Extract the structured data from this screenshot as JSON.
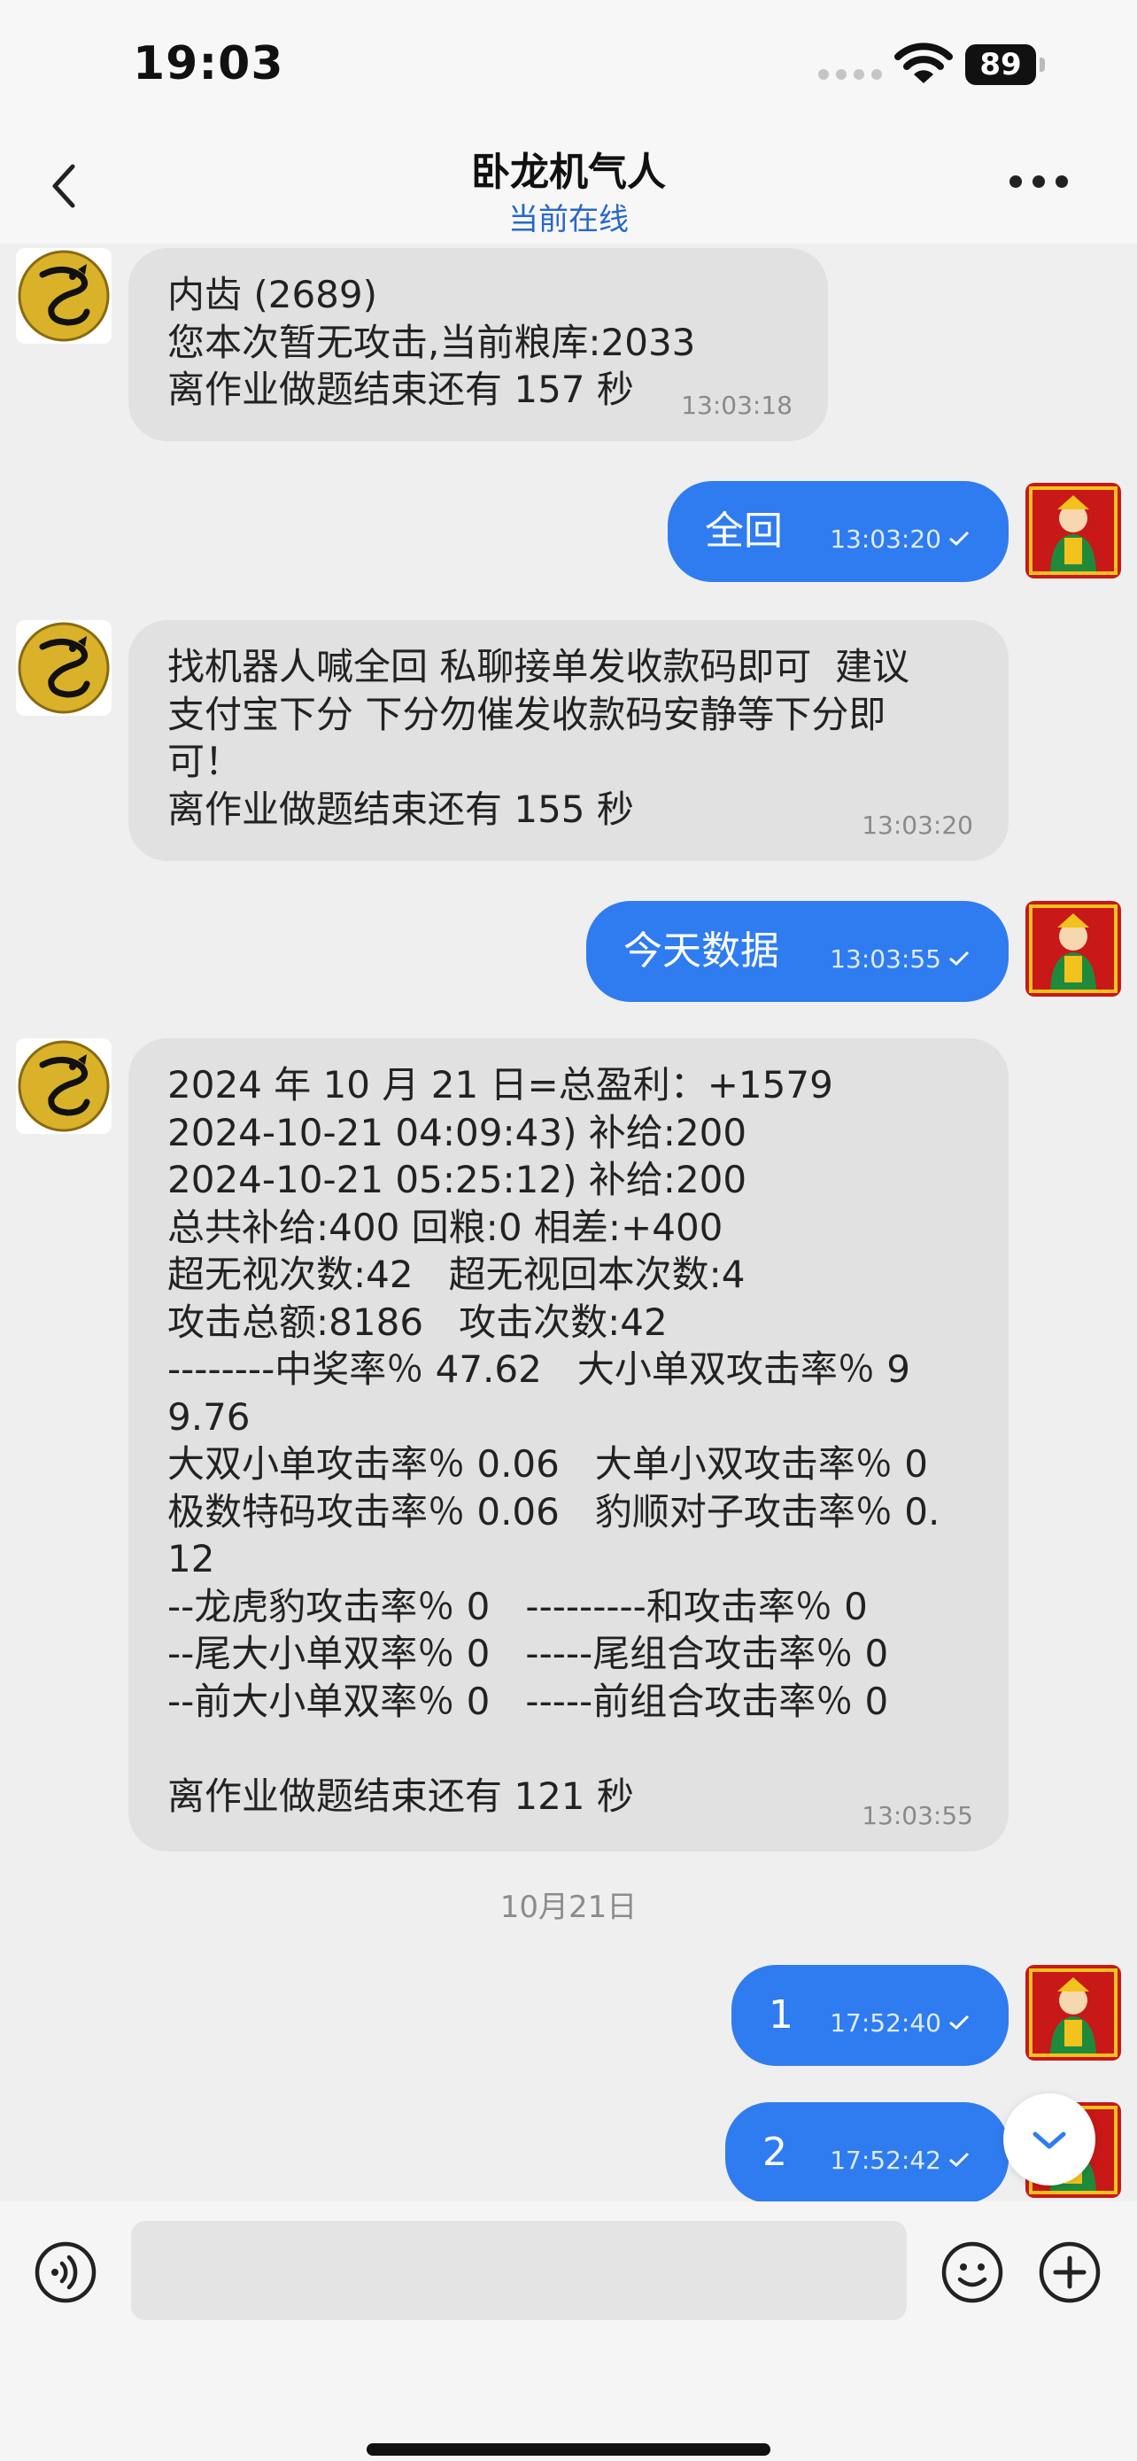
{
  "status_bar": {
    "time": "19:03",
    "battery": "89"
  },
  "header": {
    "title": "卧龙机气人",
    "subtitle": "当前在线"
  },
  "messages": [
    {
      "direction": "in",
      "lines": [
        "内齿 (2689)",
        "您本次暂无攻击,当前粮库:2033",
        "离作业做题结束还有 157 秒"
      ],
      "time": "13:03:18"
    },
    {
      "direction": "out",
      "text": "全回",
      "time": "13:03:20"
    },
    {
      "direction": "in",
      "lines": [
        "找机器人喊全回 私聊接单发收款码即可  建议",
        "支付宝下分 下分勿催发收款码安静等下分即",
        "可！",
        "离作业做题结束还有 155 秒"
      ],
      "time": "13:03:20"
    },
    {
      "direction": "out",
      "text": "今天数据",
      "time": "13:03:55"
    },
    {
      "direction": "in",
      "lines": [
        "2024 年 10 月 21 日=总盈利：+1579",
        "2024-10-21 04:09:43) 补给:200",
        "2024-10-21 05:25:12) 补给:200",
        "总共补给:400 回粮:0 相差:+400",
        "超无视次数:42   超无视回本次数:4",
        "攻击总额:8186   攻击次数:42",
        "--------中奖率％ 47.62   大小单双攻击率％ 9",
        "9.76",
        "大双小单攻击率％ 0.06   大单小双攻击率％ 0",
        "极数特码攻击率％ 0.06   豹顺对子攻击率％ 0.",
        "12",
        "--龙虎豹攻击率％ 0   ---------和攻击率％ 0",
        "--尾大小单双率％ 0   -----尾组合攻击率％ 0",
        "--前大小单双率％ 0   -----前组合攻击率％ 0",
        "",
        "离作业做题结束还有 121 秒"
      ],
      "time": "13:03:55"
    },
    {
      "direction": "out",
      "text": "1",
      "time": "17:52:40"
    },
    {
      "direction": "out",
      "text": "2",
      "time": "17:52:42"
    }
  ],
  "date_separator": "10月21日",
  "colors": {
    "accent": "#2f7cf0",
    "incoming_bubble": "#e1e1e1",
    "online": "#2768c8"
  },
  "icons": [
    "back-icon",
    "more-icon",
    "read-check-icon",
    "scroll-down-icon",
    "voice-icon",
    "emoji-icon",
    "plus-icon"
  ]
}
